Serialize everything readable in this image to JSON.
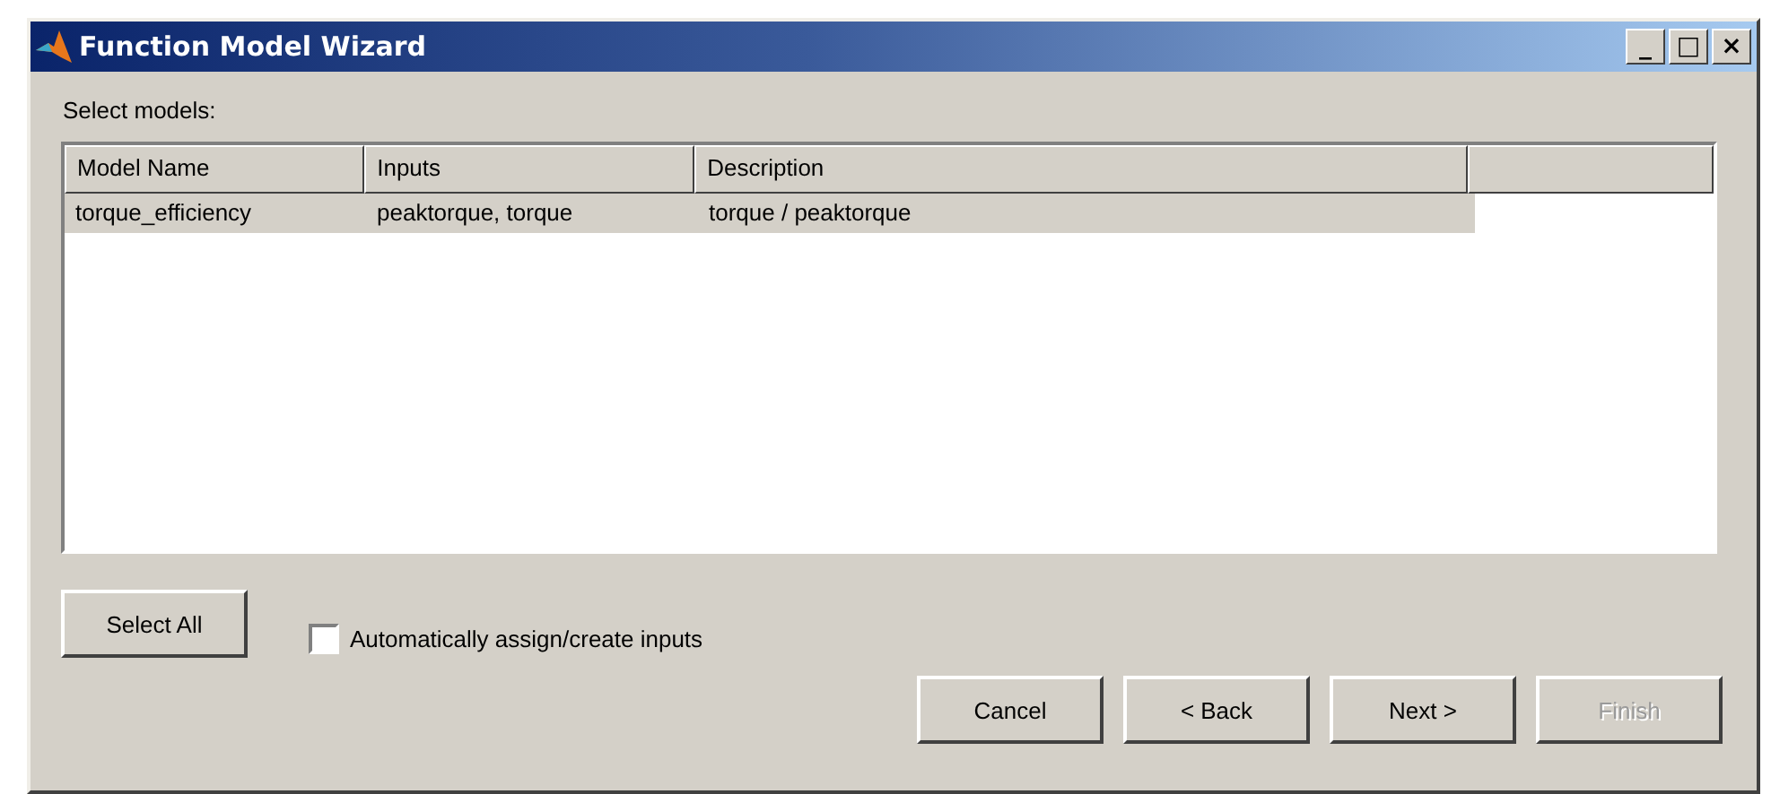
{
  "window": {
    "title": "Function Model Wizard",
    "controls": [
      "_",
      "□",
      "×"
    ]
  },
  "prompt": "Select models:",
  "table": {
    "columns": [
      "Model Name",
      "Inputs",
      "Description"
    ],
    "rows": [
      {
        "cells": [
          "torque_efficiency",
          "peaktorque, torque",
          "torque / peaktorque"
        ],
        "selected": true
      }
    ]
  },
  "select_all": "Select All",
  "auto_assign": {
    "label": "Automatically assign/create inputs",
    "checked": false
  },
  "buttons": [
    {
      "label": "Cancel",
      "disabled": false
    },
    {
      "label": "< Back",
      "disabled": false
    },
    {
      "label": "Next >",
      "disabled": false
    },
    {
      "label": "Finish",
      "disabled": true
    }
  ]
}
